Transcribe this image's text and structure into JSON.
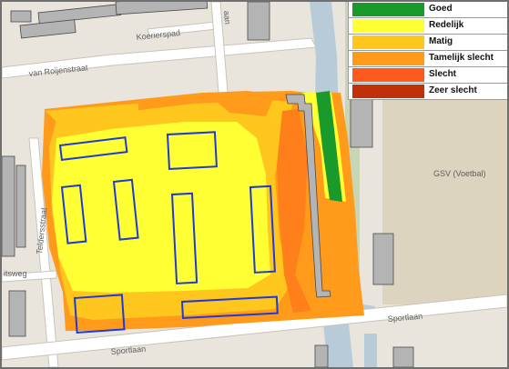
{
  "legend": {
    "items": [
      {
        "label": "Goed",
        "color": "#1a9a2a"
      },
      {
        "label": "Redelijk",
        "color": "#ffff33"
      },
      {
        "label": "Matig",
        "color": "#ffc61e"
      },
      {
        "label": "Tamelijk slecht",
        "color": "#ff9a1a"
      },
      {
        "label": "Slecht",
        "color": "#ff5a1e"
      },
      {
        "label": "Zeer slecht",
        "color": "#c0300a"
      }
    ]
  },
  "map": {
    "street_labels": {
      "koeriersterpad": "Koerierspad",
      "van_roijenstraat": "van Roijenstraat",
      "teldersstraat": "Teldersstraat",
      "sportlaan_bottom": "Sportlaan",
      "sportlaan_right": "Sportlaan",
      "sweg": "itsweg",
      "gsv": "GSV (Voetbal)",
      "aan": "aan"
    }
  }
}
